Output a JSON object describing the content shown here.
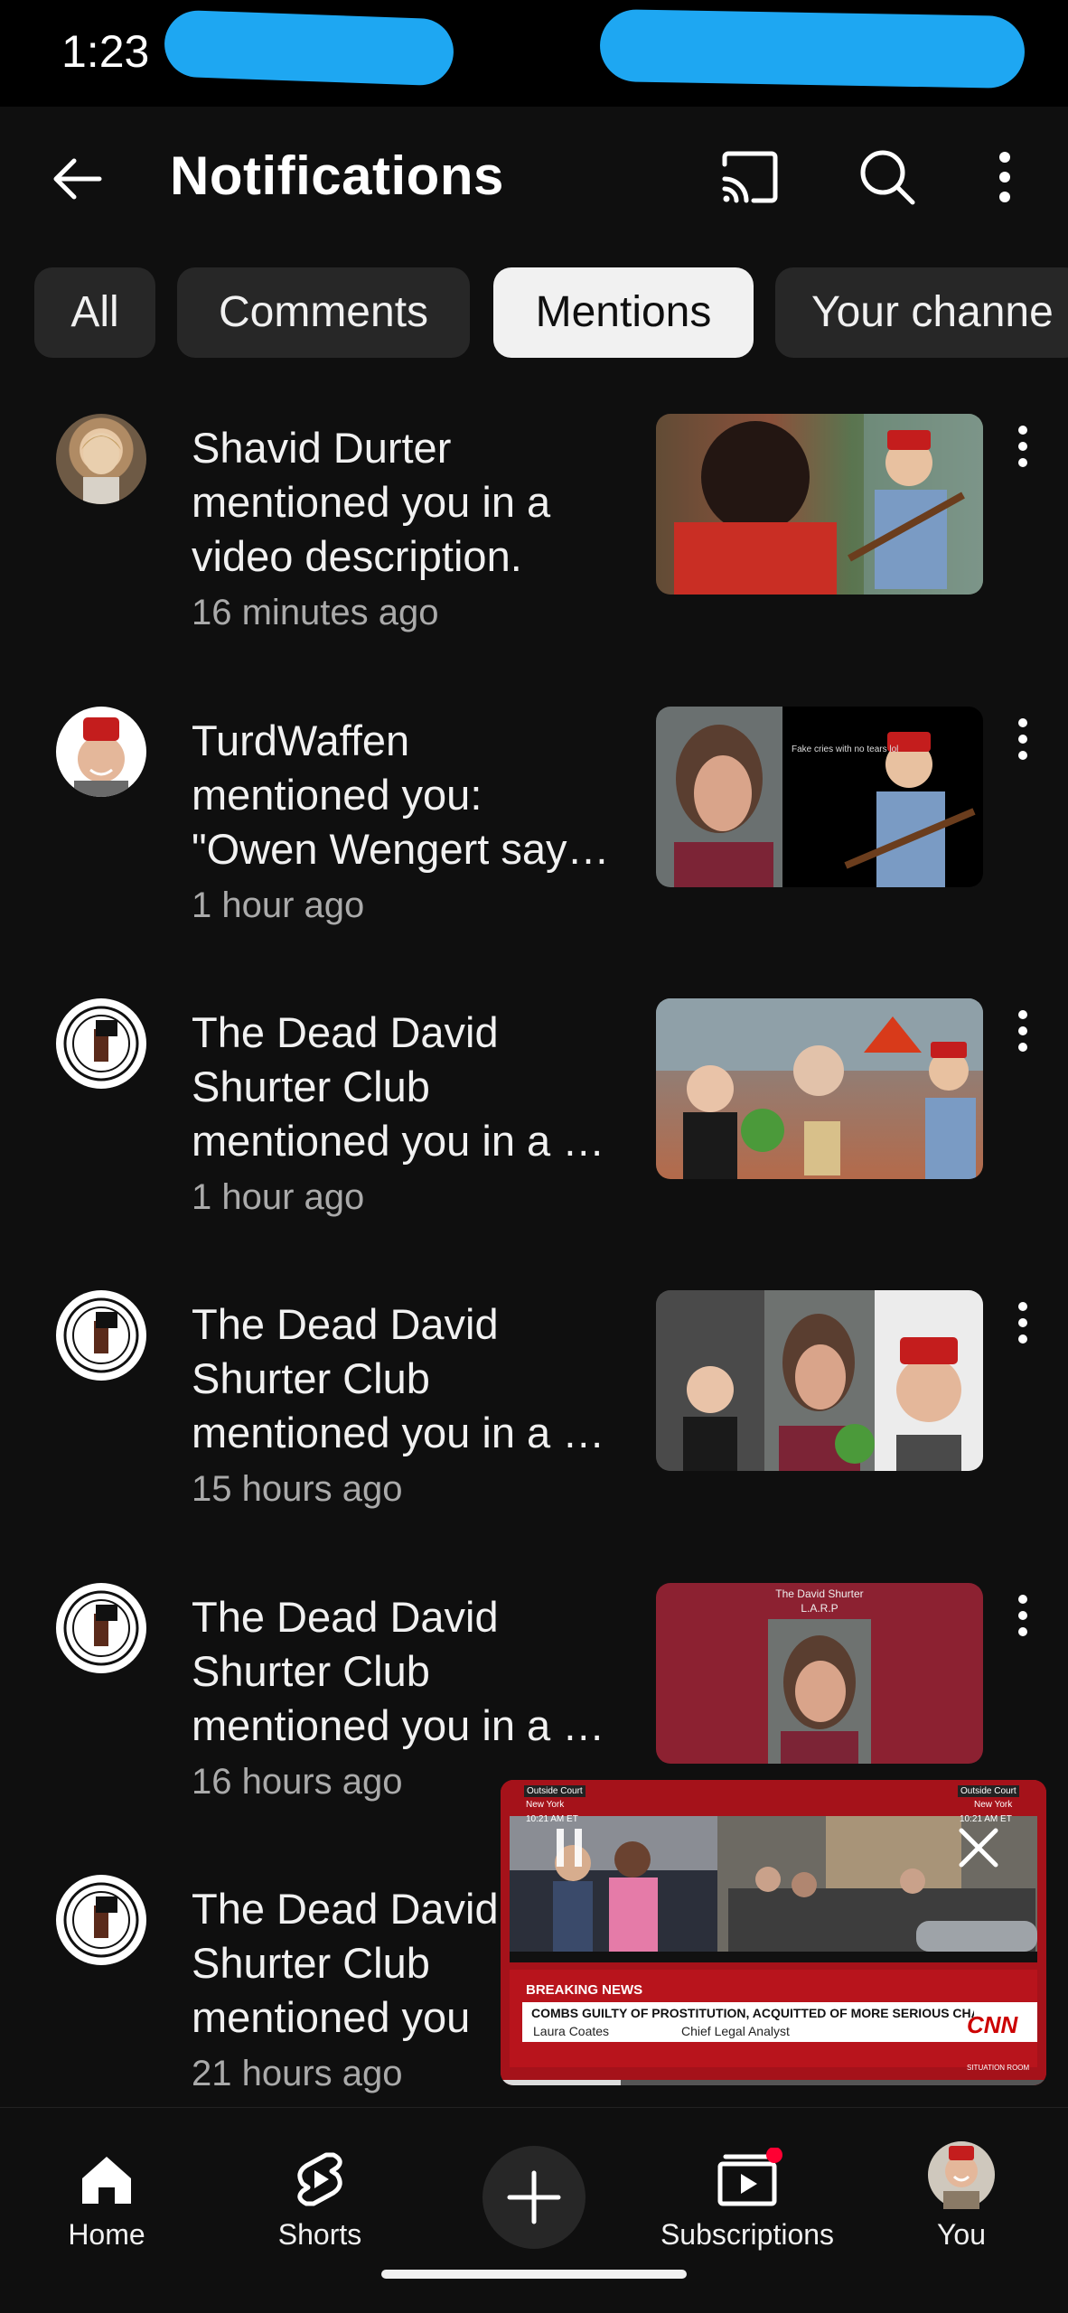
{
  "status_bar": {
    "time": "1:23"
  },
  "app_bar": {
    "title": "Notifications"
  },
  "chips": [
    {
      "label": "All"
    },
    {
      "label": "Comments"
    },
    {
      "label": "Mentions"
    },
    {
      "label": "Your channe"
    }
  ],
  "notifications": [
    {
      "lines": [
        "Shavid Durter",
        "mentioned you in a",
        "video description."
      ],
      "time": "16 minutes ago"
    },
    {
      "lines": [
        "TurdWaffen",
        "mentioned you:",
        "\"Owen Wengert say…"
      ],
      "time": "1 hour ago",
      "thumb_caption": "Fake cries with no tears lol"
    },
    {
      "lines": [
        "The Dead David",
        "Shurter Club",
        "mentioned you in a …"
      ],
      "time": "1 hour ago"
    },
    {
      "lines": [
        "The Dead David",
        "Shurter Club",
        "mentioned you in a …"
      ],
      "time": "15 hours ago"
    },
    {
      "lines": [
        "The Dead David",
        "Shurter Club",
        "mentioned you in a …"
      ],
      "time": "16 hours ago",
      "thumb_caption": "The David Shurter L.A.R.P"
    },
    {
      "lines": [
        "The Dead David",
        "Shurter Club",
        "mentioned you"
      ],
      "time": "21 hours ago"
    }
  ],
  "mini_player": {
    "location_left": "Outside Court",
    "city_left": "New York",
    "clock_left": "10:21 AM ET",
    "location_right": "Outside Court",
    "city_right": "New York",
    "clock_right": "10:21 AM ET",
    "breaking": "BREAKING NEWS",
    "headline": "COMBS GUILTY OF PROSTITUTION, ACQUITTED OF MORE SERIOUS CHARGES",
    "lower_name": "Laura Coates",
    "lower_role": "Chief Legal Analyst",
    "network": "CNN",
    "tag": "SITUATION ROOM",
    "progress": 0.22
  },
  "bottom_nav": {
    "home": "Home",
    "shorts": "Shorts",
    "subscriptions": "Subscriptions",
    "you": "You"
  },
  "colors": {
    "background": "#0f0f0f",
    "chip": "#272727",
    "accent_red": "#ff0033",
    "redaction": "#1ea7f2"
  }
}
